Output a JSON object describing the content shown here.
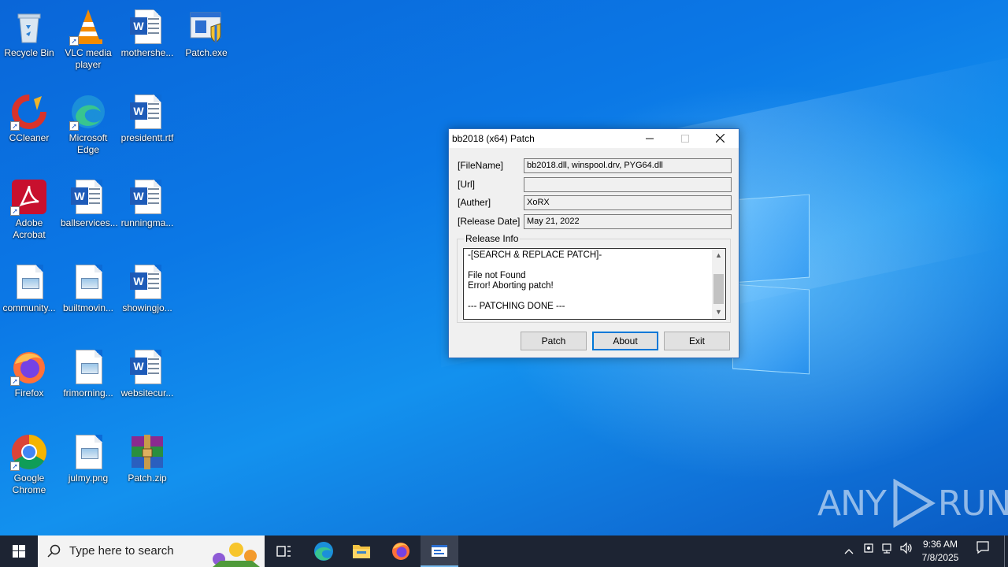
{
  "desktop": {
    "icons": [
      {
        "label": "Recycle Bin"
      },
      {
        "label": "VLC media player"
      },
      {
        "label": "mothershe..."
      },
      {
        "label": "Patch.exe"
      },
      {
        "label": "CCleaner"
      },
      {
        "label": "Microsoft Edge"
      },
      {
        "label": "presidentt.rtf"
      },
      {
        "label": "Adobe Acrobat"
      },
      {
        "label": "ballservices..."
      },
      {
        "label": "runningma..."
      },
      {
        "label": "community..."
      },
      {
        "label": "builtmovin..."
      },
      {
        "label": "showingjo..."
      },
      {
        "label": "Firefox"
      },
      {
        "label": "frimorning..."
      },
      {
        "label": "websitecur..."
      },
      {
        "label": "Google Chrome"
      },
      {
        "label": "julmy.png"
      },
      {
        "label": "Patch.zip"
      }
    ]
  },
  "window": {
    "title": "bb2018 (x64) Patch",
    "fields": {
      "filename_label": "[FileName]",
      "filename_value": "bb2018.dll, winspool.drv, PYG64.dll",
      "url_label": "[Url]",
      "url_value": "",
      "author_label": "[Auther]",
      "author_value": "XoRX",
      "release_label": "[Release Date]",
      "release_value": "May 21, 2022"
    },
    "release_info_label": "Release Info",
    "log_lines": "-[SEARCH & REPLACE PATCH]-\n\nFile not Found\nError! Aborting patch!\n\n--- PATCHING DONE ---",
    "buttons": {
      "patch": "Patch",
      "about": "About",
      "exit": "Exit"
    }
  },
  "watermark": {
    "text_left": "ANY",
    "text_right": "RUN"
  },
  "taskbar": {
    "search_placeholder": "Type here to search",
    "time": "9:36 AM",
    "date": "7/8/2025"
  },
  "colors": {
    "accent": "#0078d7",
    "taskbar": "#1d2433",
    "wallpaper": "#0b78e6"
  }
}
